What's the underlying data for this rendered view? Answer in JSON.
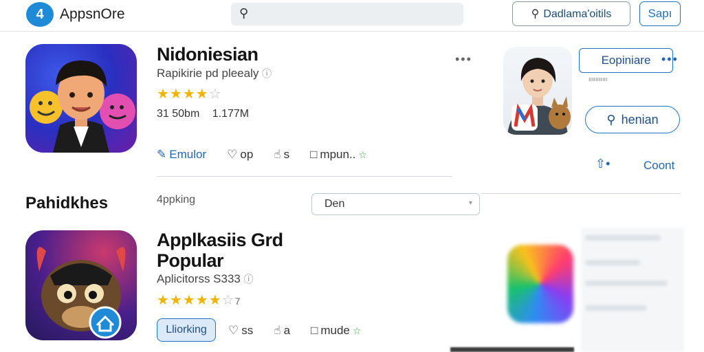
{
  "header": {
    "logo_glyph": "4",
    "brand": "AppsnOre",
    "search_placeholder": "",
    "search_button_label": "Dadlama'oitils",
    "save_button_label": "Sapı"
  },
  "app1": {
    "title": "Nidoniesian",
    "subtitle": "Rapikirie pd pleealy",
    "rating_stars_filled": 3.5,
    "rating_stars_total": 5,
    "meta_size": "31 50bm",
    "meta_downloads": "1.177M",
    "actions": {
      "edit": "Emulor",
      "like": "op",
      "thumbs": "s",
      "comment": "mpun.."
    },
    "more_label": "•••"
  },
  "right_panel": {
    "primary_button": "Eopiniare",
    "more_label": "•••",
    "note": "ııııııııııı",
    "follow_button": "henian",
    "count_label": "Coont"
  },
  "section": {
    "title": "Pahidkhes",
    "tag": "4ppking",
    "filter_value": "Den"
  },
  "app2": {
    "title_line1": "Applkasiis Grd",
    "title_line2": "Popular",
    "subtitle": "Aplicitorss S333",
    "rating_stars_filled": 4.5,
    "rating_stars_total": 5,
    "rating_count": "7",
    "actions": {
      "primary": "Lliorking",
      "like": "ss",
      "thumbs": "a",
      "comment": "mude"
    }
  },
  "colors": {
    "accent": "#1f73c0",
    "star": "#f0b400",
    "logo": "#1f8ad6"
  }
}
